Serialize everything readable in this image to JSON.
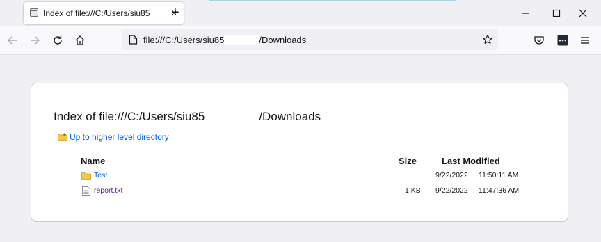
{
  "browser": {
    "tab": {
      "title": "Index of file:///C:/Users/siu85",
      "close_glyph": "×"
    },
    "new_tab_glyph": "+",
    "url": {
      "prefix": "file:///C:/Users/siu85",
      "suffix": "/Downloads"
    },
    "icons": [
      "back-icon",
      "forward-icon",
      "reload-icon",
      "home-icon",
      "page-icon",
      "bookmark-star-icon",
      "pocket-icon",
      "extension-icon",
      "menu-icon",
      "minimize-icon",
      "maximize-icon",
      "close-icon"
    ]
  },
  "listing": {
    "title_prefix": "Index of file:///C:/Users/siu85",
    "title_suffix": "/Downloads",
    "up_link": "Up to higher level directory",
    "columns": {
      "name": "Name",
      "size": "Size",
      "modified": "Last Modified"
    },
    "rows": [
      {
        "name": "Test",
        "type": "folder",
        "size": "",
        "date": "9/22/2022",
        "time": "11:50:11 AM"
      },
      {
        "name": "report.txt",
        "type": "file",
        "size": "1 KB",
        "date": "9/22/2022",
        "time": "11:47:36 AM"
      }
    ]
  },
  "colors": {
    "link": "#0060df",
    "visited": "#551a8b",
    "folder": "#f5c842"
  }
}
